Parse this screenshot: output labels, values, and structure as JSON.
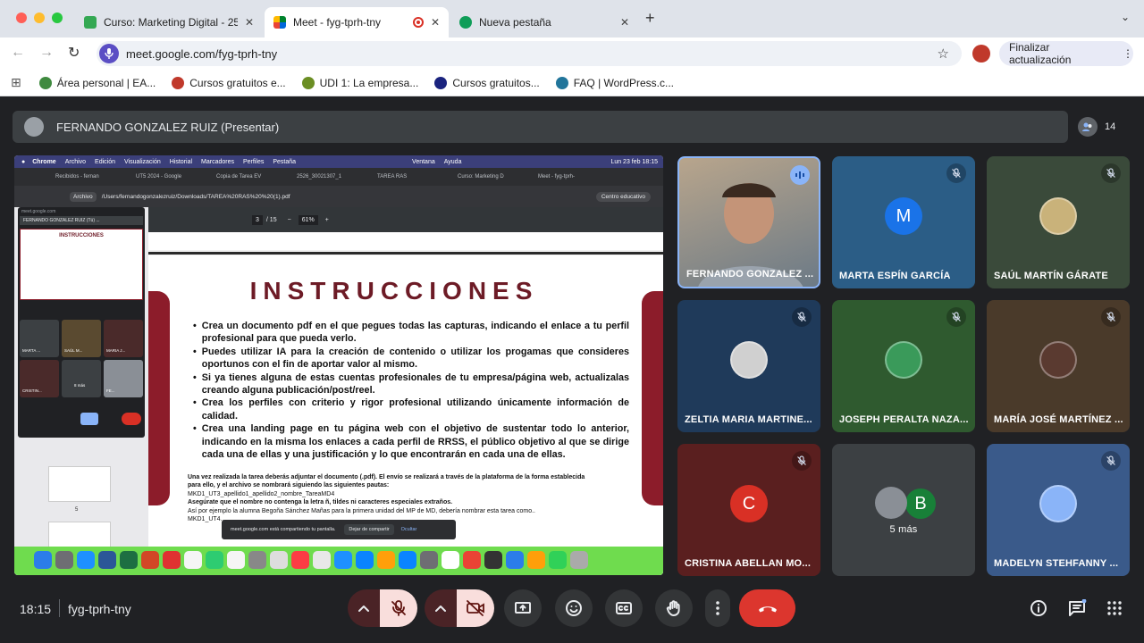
{
  "browser": {
    "tabs": [
      {
        "title": "Curso: Marketing Digital - 25",
        "color": "#34a853"
      },
      {
        "title": "Meet - fyg-tprh-tny",
        "color": "#00832d"
      },
      {
        "title": "Nueva pestaña",
        "color": "#0f9d58"
      }
    ],
    "url": "meet.google.com/fyg-tprh-tny",
    "update_button": "Finalizar actualización",
    "bookmarks": [
      "Área personal | EA...",
      "Cursos gratuitos e...",
      "UDI 1: La empresa...",
      "Cursos gratuitos...",
      "FAQ | WordPress.c..."
    ]
  },
  "meet": {
    "presenter_label": "FERNANDO GONZALEZ RUIZ (Presentar)",
    "participant_count": "14",
    "time": "18:15",
    "meeting_code": "fyg-tprh-tny",
    "participants": [
      {
        "name": "FERNANDO GONZALEZ ...",
        "initial": "",
        "color": "#8a8f96",
        "mic": "speaking"
      },
      {
        "name": "MARTA ESPÍN GARCÍA",
        "initial": "M",
        "color": "#1a73e8",
        "mic": "muted"
      },
      {
        "name": "SAÚL MARTÍN GÁRATE",
        "initial": "",
        "color": "#c9b27a",
        "mic": "muted"
      },
      {
        "name": "ZELTIA MARIA MARTINE...",
        "initial": "",
        "color": "#d0d0d0",
        "mic": "muted"
      },
      {
        "name": "JOSEPH PERALTA NAZA...",
        "initial": "",
        "color": "#3a9a5a",
        "mic": "muted"
      },
      {
        "name": "MARÍA JOSÉ MARTÍNEZ ...",
        "initial": "",
        "color": "#5a3a30",
        "mic": "muted"
      },
      {
        "name": "CRISTINA ABELLAN MO...",
        "initial": "C",
        "color": "#d93025",
        "mic": "muted"
      },
      {
        "name": "5 más",
        "initial": "B",
        "color": "#188038",
        "mic": "none"
      },
      {
        "name": "MADELYN STEHFANNY ...",
        "initial": "",
        "color": "#8ab4f8",
        "mic": "muted"
      }
    ]
  },
  "shared": {
    "mac_menu": [
      "Chrome",
      "Archivo",
      "Edición",
      "Visualización",
      "Historial",
      "Marcadores",
      "Perfiles",
      "Pestaña",
      "Ventana",
      "Ayuda",
      "Lun 23 feb 18:15"
    ],
    "inner_tabs": [
      "Recibidos - fernan",
      "UT5 2024 - Google",
      "Copia de Tarea EV",
      "2526_30021307_1",
      "TAREA RAS",
      "Curso: Marketing D",
      "Meet - fyg-tprh-"
    ],
    "file_path": "/Users/fernandogonzalezruiz/Downloads/TAREA%20RAS%20%20(1).pdf",
    "file_label": "Archivo",
    "profile_label": "Centro educativo",
    "pdf_page": "3",
    "pdf_total": "/ 15",
    "pdf_zoom": "61%",
    "doc_title": "INSTRUCCIONES",
    "bullets": [
      "Crea un documento pdf en el que pegues todas las capturas, indicando el enlace a tu perfil profesional para que pueda verlo.",
      "Puedes utilizar IA para la creación de contenido o utilizar los progamas que consideres oportunos con el fin de aportar valor al mismo.",
      "Si ya tienes alguna de estas cuentas profesionales de tu empresa/página web, actualizalas creando alguna publicación/post/reel.",
      "Crea los perfiles con criterio y rigor profesional utilizando únicamente información de calidad.",
      "Crea una landing page en tu página web con el objetivo de sustentar todo lo anterior, indicando en la misma los enlaces a cada perfil de RRSS, el público objetivo al que se dirige cada una de ellas y una justificación y lo que encontrarán en cada una de ellas."
    ],
    "small_text": [
      "Una vez realizada la tarea deberás adjuntar el documento (.pdf). El envío se realizará a través de la plataforma de la forma establecida para ello, y el archivo se nombrará siguiendo las siguientes pautas:",
      "MKD1_UT3_apellido1_apellido2_nombre_TareaMD4",
      "Asegúrate que el nombre no contenga la letra ñ, tildes ni caracteres especiales extraños.",
      "Así por ejemplo la alumna Begoña Sánchez Mañas para la primera unidad del MP de MD, debería nombrar esta tarea como..",
      "MKD1_UT4..."
    ],
    "share_notice": "meet.google.com está compartiendo tu pantalla.",
    "share_stop": "Dejar de compartir",
    "share_hide": "Ocultar",
    "mini_url": "meet.google.com",
    "mini_presenter": "FERNANDO GONZALEZ RUIZ (Tú) ...",
    "mini_title": "INSTRUCCIONES",
    "mini_names": [
      "MARTA ...",
      "SAÚL M...",
      "MARIA J...",
      "CRISTIN...",
      "8 más",
      "FE..."
    ],
    "thumb_num": "5"
  }
}
